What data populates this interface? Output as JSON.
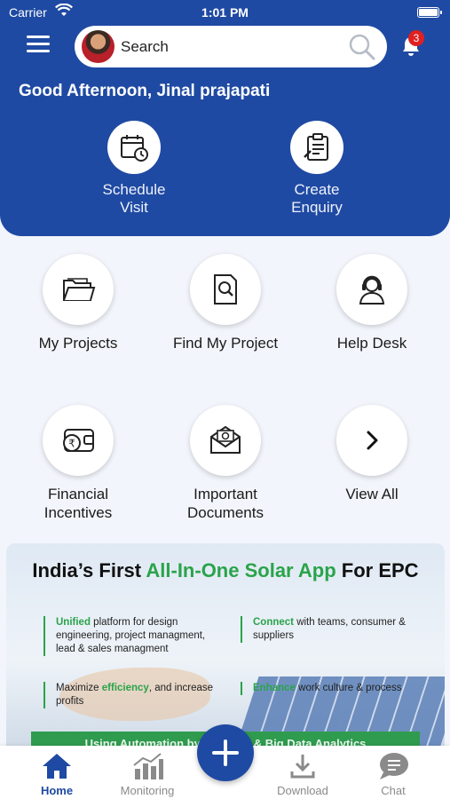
{
  "status_bar": {
    "carrier": "Carrier",
    "time": "1:01 PM"
  },
  "search": {
    "placeholder": "Search"
  },
  "notifications": {
    "count": "3"
  },
  "greeting": "Good Afternoon, Jinal prajapati",
  "quick_actions": [
    {
      "label": "Schedule\nVisit",
      "icon": "calendar-clock-icon"
    },
    {
      "label": "Create\nEnquiry",
      "icon": "clipboard-icon"
    }
  ],
  "tiles": [
    {
      "label": "My Projects",
      "icon": "folder-icon"
    },
    {
      "label": "Find My Project",
      "icon": "document-search-icon"
    },
    {
      "label": "Help Desk",
      "icon": "support-agent-icon"
    },
    {
      "label": "Financial\nIncentives",
      "icon": "wallet-rupee-icon"
    },
    {
      "label": "Important\nDocuments",
      "icon": "mail-badge-icon"
    },
    {
      "label": "View All",
      "icon": "chevron-right-icon"
    }
  ],
  "banner": {
    "title_prefix": "India’s First ",
    "title_highlight": "All-In-One Solar App",
    "title_suffix": " For EPC",
    "points": [
      {
        "strong": "Unified",
        "rest": " platform for design engineering, project managment, lead & sales managment"
      },
      {
        "strong": "Connect",
        "rest": " with teams, consumer & suppliers"
      },
      {
        "pre": "Maximize ",
        "strong": "efficiency",
        "rest": ", and increase profits"
      },
      {
        "strong": "Enhance",
        "rest": " work culture & process"
      }
    ],
    "strip": "Using Automation by AI, Tech. & Big Data Analytics"
  },
  "bottom_nav": [
    {
      "label": "Home",
      "icon": "home-icon",
      "active": true
    },
    {
      "label": "Monitoring",
      "icon": "bar-chart-icon",
      "active": false
    },
    {
      "label": "Download",
      "icon": "download-icon",
      "active": false
    },
    {
      "label": "Chat",
      "icon": "chat-icon",
      "active": false
    }
  ],
  "colors": {
    "primary": "#1f4aa3",
    "accent_green": "#2aa34a",
    "badge_red": "#e02020"
  }
}
